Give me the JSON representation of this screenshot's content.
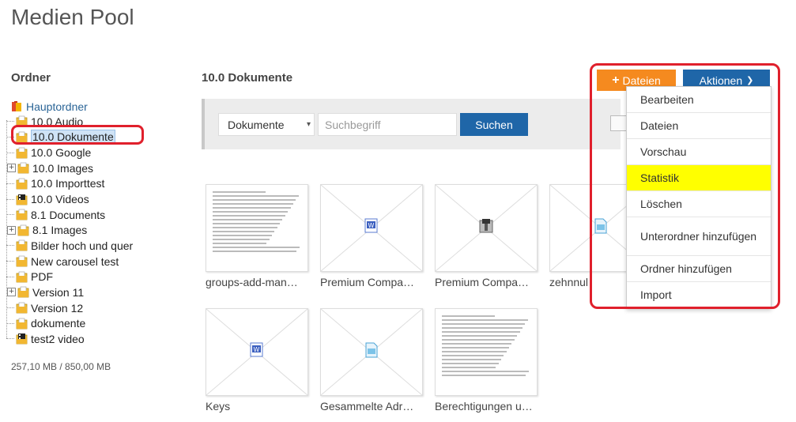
{
  "page": {
    "title": "Medien Pool"
  },
  "folders": {
    "heading": "Ordner",
    "root": "Hauptordner",
    "items": [
      {
        "label": "10.0 Audio",
        "expandable": false,
        "selected": false,
        "icon": "folder-doc-icon"
      },
      {
        "label": "10.0 Dokumente",
        "expandable": false,
        "selected": true,
        "icon": "folder-doc-icon"
      },
      {
        "label": "10.0 Google",
        "expandable": false,
        "selected": false,
        "icon": "folder-doc-icon"
      },
      {
        "label": "10.0 Images",
        "expandable": true,
        "selected": false,
        "icon": "folder-doc-icon"
      },
      {
        "label": "10.0 Importtest",
        "expandable": false,
        "selected": false,
        "icon": "folder-doc-icon"
      },
      {
        "label": "10.0 Videos",
        "expandable": false,
        "selected": false,
        "icon": "folder-video-icon"
      },
      {
        "label": "8.1 Documents",
        "expandable": false,
        "selected": false,
        "icon": "folder-doc-icon"
      },
      {
        "label": "8.1 Images",
        "expandable": true,
        "selected": false,
        "icon": "folder-doc-icon"
      },
      {
        "label": "Bilder hoch und quer",
        "expandable": false,
        "selected": false,
        "icon": "folder-doc-icon"
      },
      {
        "label": "New carousel test",
        "expandable": false,
        "selected": false,
        "icon": "folder-doc-icon"
      },
      {
        "label": "PDF",
        "expandable": false,
        "selected": false,
        "icon": "folder-doc-icon"
      },
      {
        "label": "Version 11",
        "expandable": true,
        "selected": false,
        "icon": "folder-doc-icon"
      },
      {
        "label": "Version 12",
        "expandable": false,
        "selected": false,
        "icon": "folder-doc-icon"
      },
      {
        "label": "dokumente",
        "expandable": false,
        "selected": false,
        "icon": "folder-doc-icon"
      },
      {
        "label": "test2 video",
        "expandable": false,
        "selected": false,
        "icon": "folder-video-icon"
      }
    ],
    "quota": "257,10 MB / 850,00 MB"
  },
  "content": {
    "heading": "10.0 Dokumente",
    "search": {
      "type_selected": "Dokumente",
      "placeholder": "Suchbegriff",
      "value": "",
      "button": "Suchen"
    },
    "files": [
      {
        "label": "groups-add-man…",
        "thumb": "document-preview",
        "icon": ""
      },
      {
        "label": "Premium Compa…",
        "thumb": "placeholder",
        "icon": "word-file-icon"
      },
      {
        "label": "Premium Compa…",
        "thumb": "placeholder",
        "icon": "archive-file-icon"
      },
      {
        "label": "zehnnul",
        "thumb": "placeholder",
        "icon": "generic-file-icon"
      },
      {
        "label": "Keys",
        "thumb": "placeholder",
        "icon": "word-file-icon"
      },
      {
        "label": "Gesammelte Adr…",
        "thumb": "placeholder",
        "icon": "generic-file-icon"
      },
      {
        "label": "Berechtigungen u…",
        "thumb": "document-preview",
        "icon": ""
      }
    ]
  },
  "actions": {
    "upload_button": "Dateien",
    "actions_button": "Aktionen",
    "menu": [
      {
        "label": "Bearbeiten",
        "active": false
      },
      {
        "label": "Dateien",
        "active": false
      },
      {
        "label": "Vorschau",
        "active": false
      },
      {
        "label": "Statistik",
        "active": true
      },
      {
        "label": "Löschen",
        "active": false
      },
      {
        "label": "Unterordner hinzufügen",
        "active": false
      },
      {
        "label": "Ordner hinzufügen",
        "active": false
      },
      {
        "label": "Import",
        "active": false
      }
    ]
  },
  "colors": {
    "upload_button": "#f58a1f",
    "primary_button": "#1f66a8",
    "highlight": "#ffff00",
    "annotation": "#e0202c"
  }
}
